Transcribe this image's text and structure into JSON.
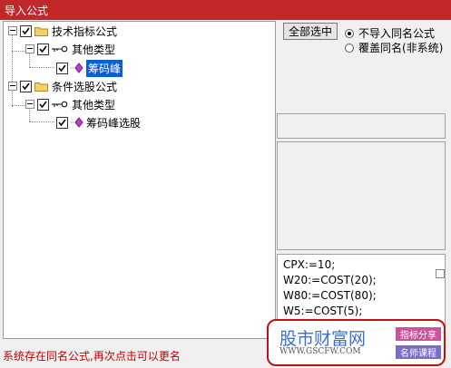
{
  "window": {
    "title": "导入公式"
  },
  "tree": {
    "root1": {
      "label": "技术指标公式"
    },
    "root1_child": {
      "label": "其他类型"
    },
    "root1_leaf": {
      "label": "筹码峰"
    },
    "root2": {
      "label": "条件选股公式"
    },
    "root2_child": {
      "label": "其他类型"
    },
    "root2_leaf": {
      "label": "筹码峰选股"
    }
  },
  "controls": {
    "select_all": "全部选中",
    "radio_skip": "不导入同名公式",
    "radio_overwrite": "覆盖同名(非系统)",
    "selected_radio": "radio_skip"
  },
  "code_lines": [
    "CPX:=10;",
    "W20:=COST(20);",
    "W80:=COST(80);",
    "W5:=COST(5);"
  ],
  "status": "系统存在同名公式,再次点击可以更名",
  "watermark": {
    "cn": "股市财富网",
    "en": "WWW.GSCFW.COM",
    "tag1": "指标分享",
    "tag2": "名师课程"
  },
  "colors": {
    "titlebar": "#c0282a",
    "selection": "#0a5fd6",
    "status": "#c00000"
  }
}
